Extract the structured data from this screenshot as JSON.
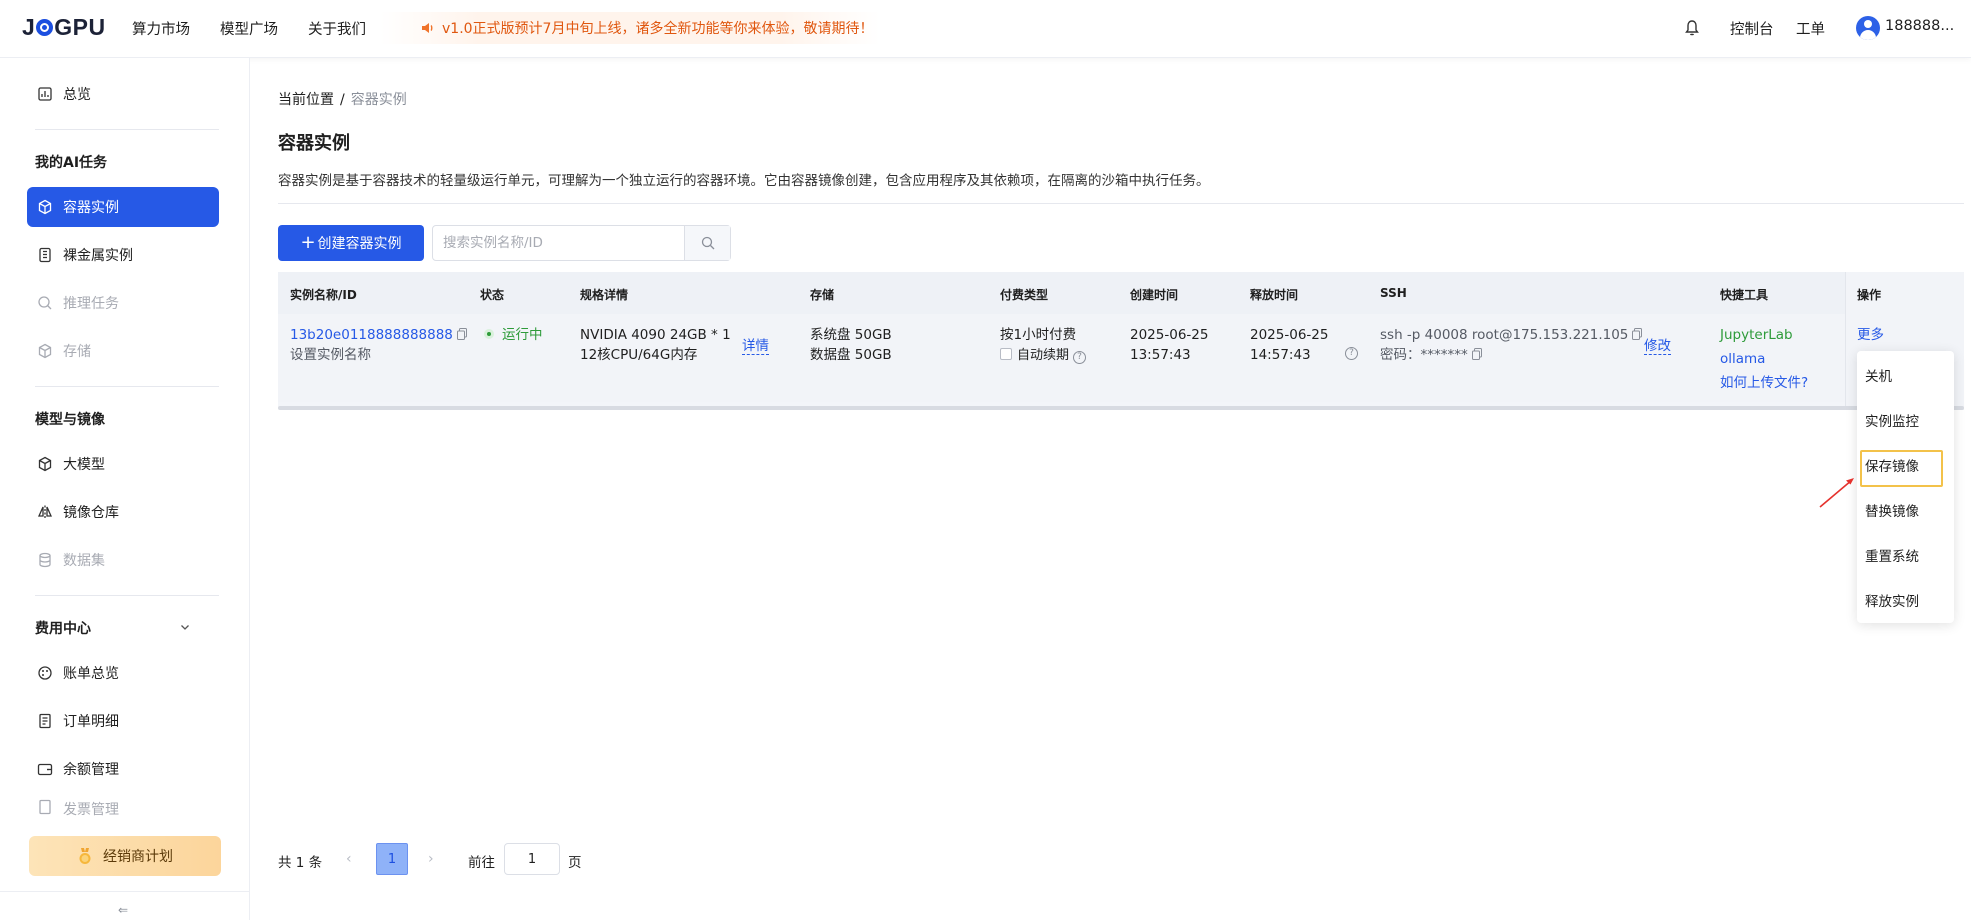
{
  "header": {
    "logo": "JOGPU",
    "nav": [
      "算力市场",
      "模型广场",
      "关于我们"
    ],
    "notice": "v1.0正式版预计7月中旬上线，诸多全新功能等你来体验，敬请期待！",
    "console": "控制台",
    "ticket": "工单",
    "user": "188888..."
  },
  "sidebar": {
    "overview": "总览",
    "group_ai": "我的AI任务",
    "container": "容器实例",
    "baremetal": "裸金属实例",
    "inference": "推理任务",
    "storage": "存储",
    "group_model": "模型与镜像",
    "llm": "大模型",
    "image_repo": "镜像仓库",
    "dataset": "数据集",
    "group_fee": "费用中心",
    "bill": "账单总览",
    "orders": "订单明细",
    "balance": "余额管理",
    "invoice": "发票管理",
    "dealer": "经销商计划",
    "collapse": "⇐"
  },
  "breadcrumb": {
    "label": "当前位置",
    "sep": "/",
    "current": "容器实例"
  },
  "page": {
    "title": "容器实例",
    "description": "容器实例是基于容器技术的轻量级运行单元，可理解为一个独立运行的容器环境。它由容器镜像创建，包含应用程序及其依赖项，在隔离的沙箱中执行任务。"
  },
  "toolbar": {
    "create": "创建容器实例",
    "search_placeholder": "搜索实例名称/ID"
  },
  "table": {
    "headers": {
      "name": "实例名称/ID",
      "status": "状态",
      "spec": "规格详情",
      "storage": "存储",
      "billing": "付费类型",
      "created": "创建时间",
      "release": "释放时间",
      "ssh": "SSH",
      "tools": "快捷工具",
      "ops": "操作"
    },
    "row": {
      "id": "13b20e0118888888888",
      "name_hint": "设置实例名称",
      "status": "运行中",
      "spec_gpu": "NVIDIA 4090 24GB * 1",
      "spec_cpu": "12核CPU/64G内存",
      "detail": "详情",
      "sys_disk": "系统盘 50GB",
      "data_disk": "数据盘 50GB",
      "billing": "按1小时付费",
      "auto_renew": "自动续期",
      "created_date": "2025-06-25",
      "created_time": "13:57:43",
      "release_date": "2025-06-25",
      "release_time": "14:57:43",
      "ssh_cmd": "ssh -p 40008 root@175.153.221.105",
      "password_label": "密码：",
      "password": "*******",
      "modify": "修改",
      "tool_jupyter": "JupyterLab",
      "tool_ollama": "ollama",
      "tool_upload": "如何上传文件?",
      "more": "更多"
    }
  },
  "dropdown": [
    "关机",
    "实例监控",
    "保存镜像",
    "替换镜像",
    "重置系统",
    "释放实例"
  ],
  "pagination": {
    "total": "共 1 条",
    "current": "1",
    "goto": "前往",
    "goto_value": "1",
    "page": "页"
  },
  "colors": {
    "primary": "#2659e6",
    "notice": "#e0570f",
    "running": "#2e9b3a",
    "highlight": "#f3c24a",
    "arrow": "#e5312c"
  }
}
